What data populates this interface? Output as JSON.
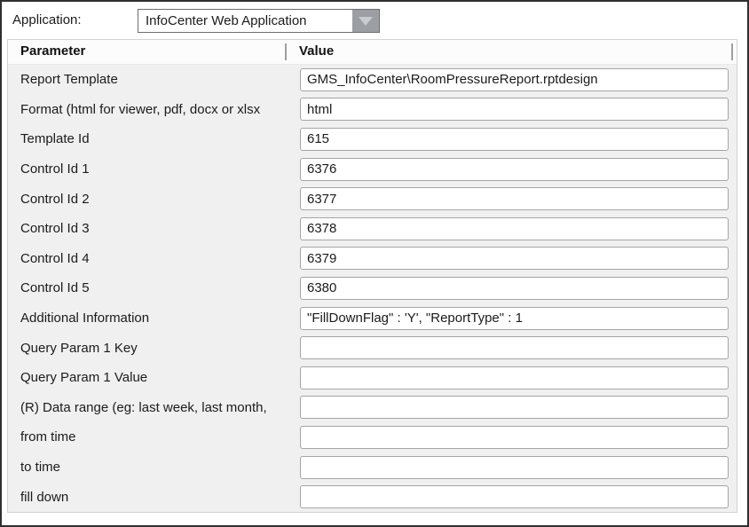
{
  "top_bar": {
    "application_label": "Application:",
    "application_dropdown": {
      "selected_value": "InfoCenter Web Application"
    }
  },
  "table": {
    "headers": {
      "parameter": "Parameter",
      "value": "Value"
    },
    "rows": [
      {
        "parameter": "Report Template",
        "value": "GMS_InfoCenter\\RoomPressureReport.rptdesign"
      },
      {
        "parameter": "Format (html for viewer, pdf, docx or xlsx",
        "value": "html"
      },
      {
        "parameter": "Template Id",
        "value": "615"
      },
      {
        "parameter": "Control Id 1",
        "value": "6376"
      },
      {
        "parameter": "Control Id 2",
        "value": "6377"
      },
      {
        "parameter": "Control Id 3",
        "value": "6378"
      },
      {
        "parameter": "Control Id 4",
        "value": "6379"
      },
      {
        "parameter": "Control Id 5",
        "value": "6380"
      },
      {
        "parameter": "Additional Information",
        "value": "\"FillDownFlag\" : 'Y', \"ReportType\" : 1"
      },
      {
        "parameter": "Query Param 1 Key",
        "value": ""
      },
      {
        "parameter": "Query Param 1 Value",
        "value": ""
      },
      {
        "parameter": "(R) Data range (eg: last week, last month,",
        "value": ""
      },
      {
        "parameter": "from time",
        "value": ""
      },
      {
        "parameter": "to time",
        "value": ""
      },
      {
        "parameter": "fill down",
        "value": ""
      }
    ]
  },
  "colors": {
    "window_border": "#2f2f2f",
    "panel_background": "#f0f0f1",
    "header_background": "#fcfcfd",
    "input_border": "#a5a5a8",
    "dropdown_button": "#9b9ea2",
    "dropdown_arrow": "#c9cbce",
    "column_divider": "#9f9fa1"
  }
}
